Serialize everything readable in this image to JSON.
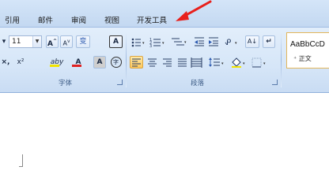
{
  "tabs": [
    {
      "label": "引用"
    },
    {
      "label": "邮件"
    },
    {
      "label": "审阅"
    },
    {
      "label": "视图"
    },
    {
      "label": "开发工具"
    }
  ],
  "font": {
    "size_value": "11",
    "grow_label": "A",
    "shrink_label": "A",
    "phonetic_label": "变",
    "border_char_label": "A",
    "clear_label": "×,",
    "superscript_label": "x²",
    "highlight_label": "aby",
    "font_color_label": "A",
    "char_shade_label": "A",
    "enclose_label": "字",
    "group_label": "字体"
  },
  "paragraph": {
    "group_label": "段落",
    "sort_label": "A↓",
    "marks_label": "↵"
  },
  "styles": {
    "preview_text": "AaBbCcD",
    "style_name": "⁺ 正文"
  },
  "colors": {
    "highlight": "#f2e400",
    "font_color": "#e02020",
    "arrow": "#e8201c",
    "active_border": "#d9a442"
  }
}
